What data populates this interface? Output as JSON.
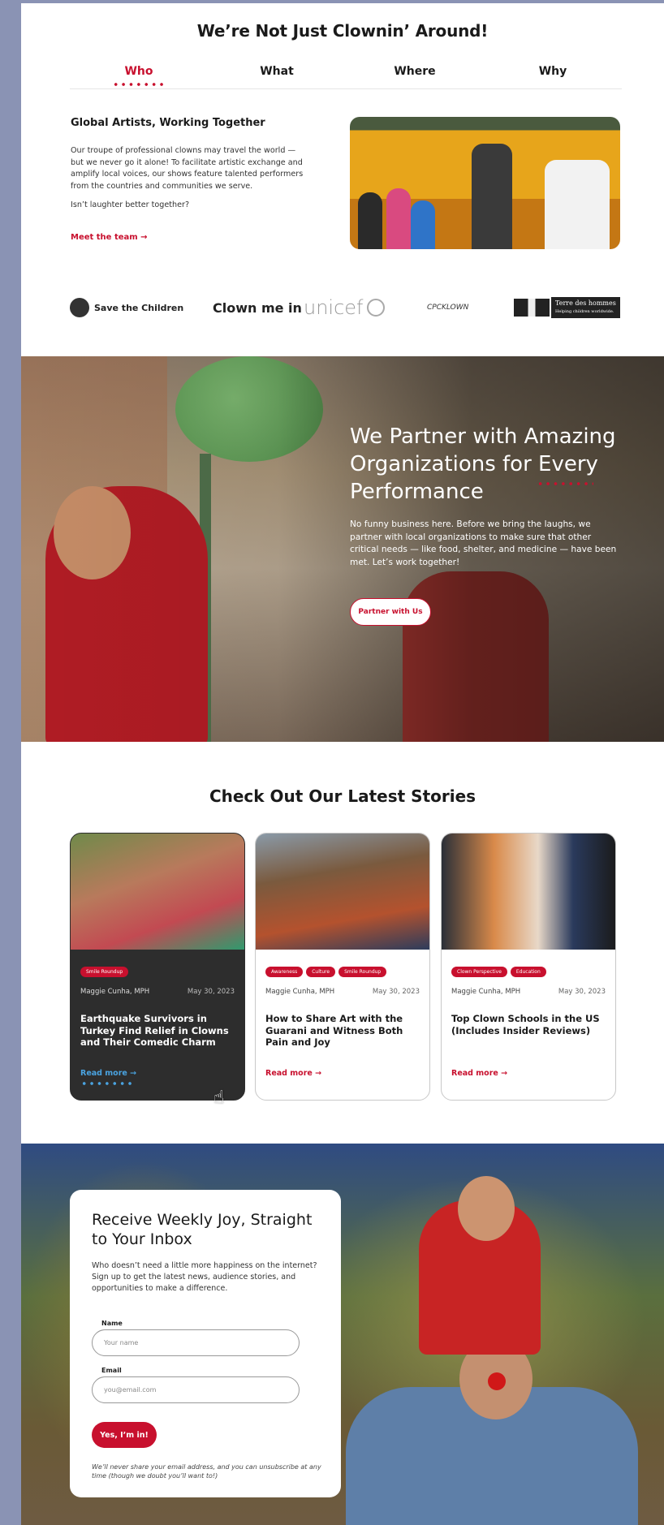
{
  "intro": {
    "title": "We’re Not Just Clownin’ Around!",
    "tabs": [
      {
        "label": "Who",
        "active": true
      },
      {
        "label": "What",
        "active": false
      },
      {
        "label": "Where",
        "active": false
      },
      {
        "label": "Why",
        "active": false
      }
    ],
    "subtitle": "Global Artists, Working Together",
    "body": "Our troupe of professional clowns may travel the world — but we never go it alone! To facilitate artistic exchange and amplify local voices, our shows feature talented performers from the countries and communities we serve.",
    "question": "Isn’t laughter better together?",
    "link": "Meet the team →"
  },
  "partners": {
    "save_the_children": "Save the Children",
    "clown_me_in": "Clown me in",
    "unicef": "unicef",
    "cpc": "CPCKLOWN",
    "tdh": "Terre des hommes",
    "tdh_sub": "Helping children worldwide."
  },
  "hero": {
    "title": "We Partner with Amazing Organizations for Every Performance",
    "body": "No funny business here. Before we bring the laughs, we partner with local organizations to make sure that other critical needs — like food, shelter, and medicine — have been met. Let’s work together!",
    "button": "Partner with Us"
  },
  "stories": {
    "title": "Check Out Our Latest Stories",
    "cards": [
      {
        "tags": [
          "Smile Roundup"
        ],
        "author": "Maggie Cunha, MPH",
        "date": "May 30, 2023",
        "title": "Earthquake Survivors in Turkey Find Relief in Clowns and Their Comedic Charm",
        "read": "Read more →",
        "highlighted": true
      },
      {
        "tags": [
          "Awareness",
          "Culture",
          "Smile Roundup"
        ],
        "author": "Maggie Cunha, MPH",
        "date": "May 30, 2023",
        "title": "How to Share Art with the Guarani and Witness Both Pain and Joy",
        "read": "Read more →",
        "highlighted": false
      },
      {
        "tags": [
          "Clown Perspective",
          "Education"
        ],
        "author": "Maggie Cunha, MPH",
        "date": "May 30, 2023",
        "title": "Top Clown Schools in the US (Includes Insider Reviews)",
        "read": "Read more →",
        "highlighted": false
      }
    ]
  },
  "newsletter": {
    "title": "Receive Weekly Joy, Straight to Your Inbox",
    "body": "Who doesn’t need a little more happiness on the internet? Sign up to get the latest news, audience stories, and opportunities to make a difference.",
    "name_label": "Name",
    "name_placeholder": "Your name",
    "email_label": "Email",
    "email_placeholder": "you@email.com",
    "button": "Yes, I’m in!",
    "note": "We’ll never share your email address, and you can unsubscribe at any time (though we doubt you’ll want to!)"
  },
  "colors": {
    "accent": "#c8102e",
    "card_dark": "#2d2d2d",
    "link_blue": "#4aa3e0",
    "frame": "#8a93b4"
  }
}
